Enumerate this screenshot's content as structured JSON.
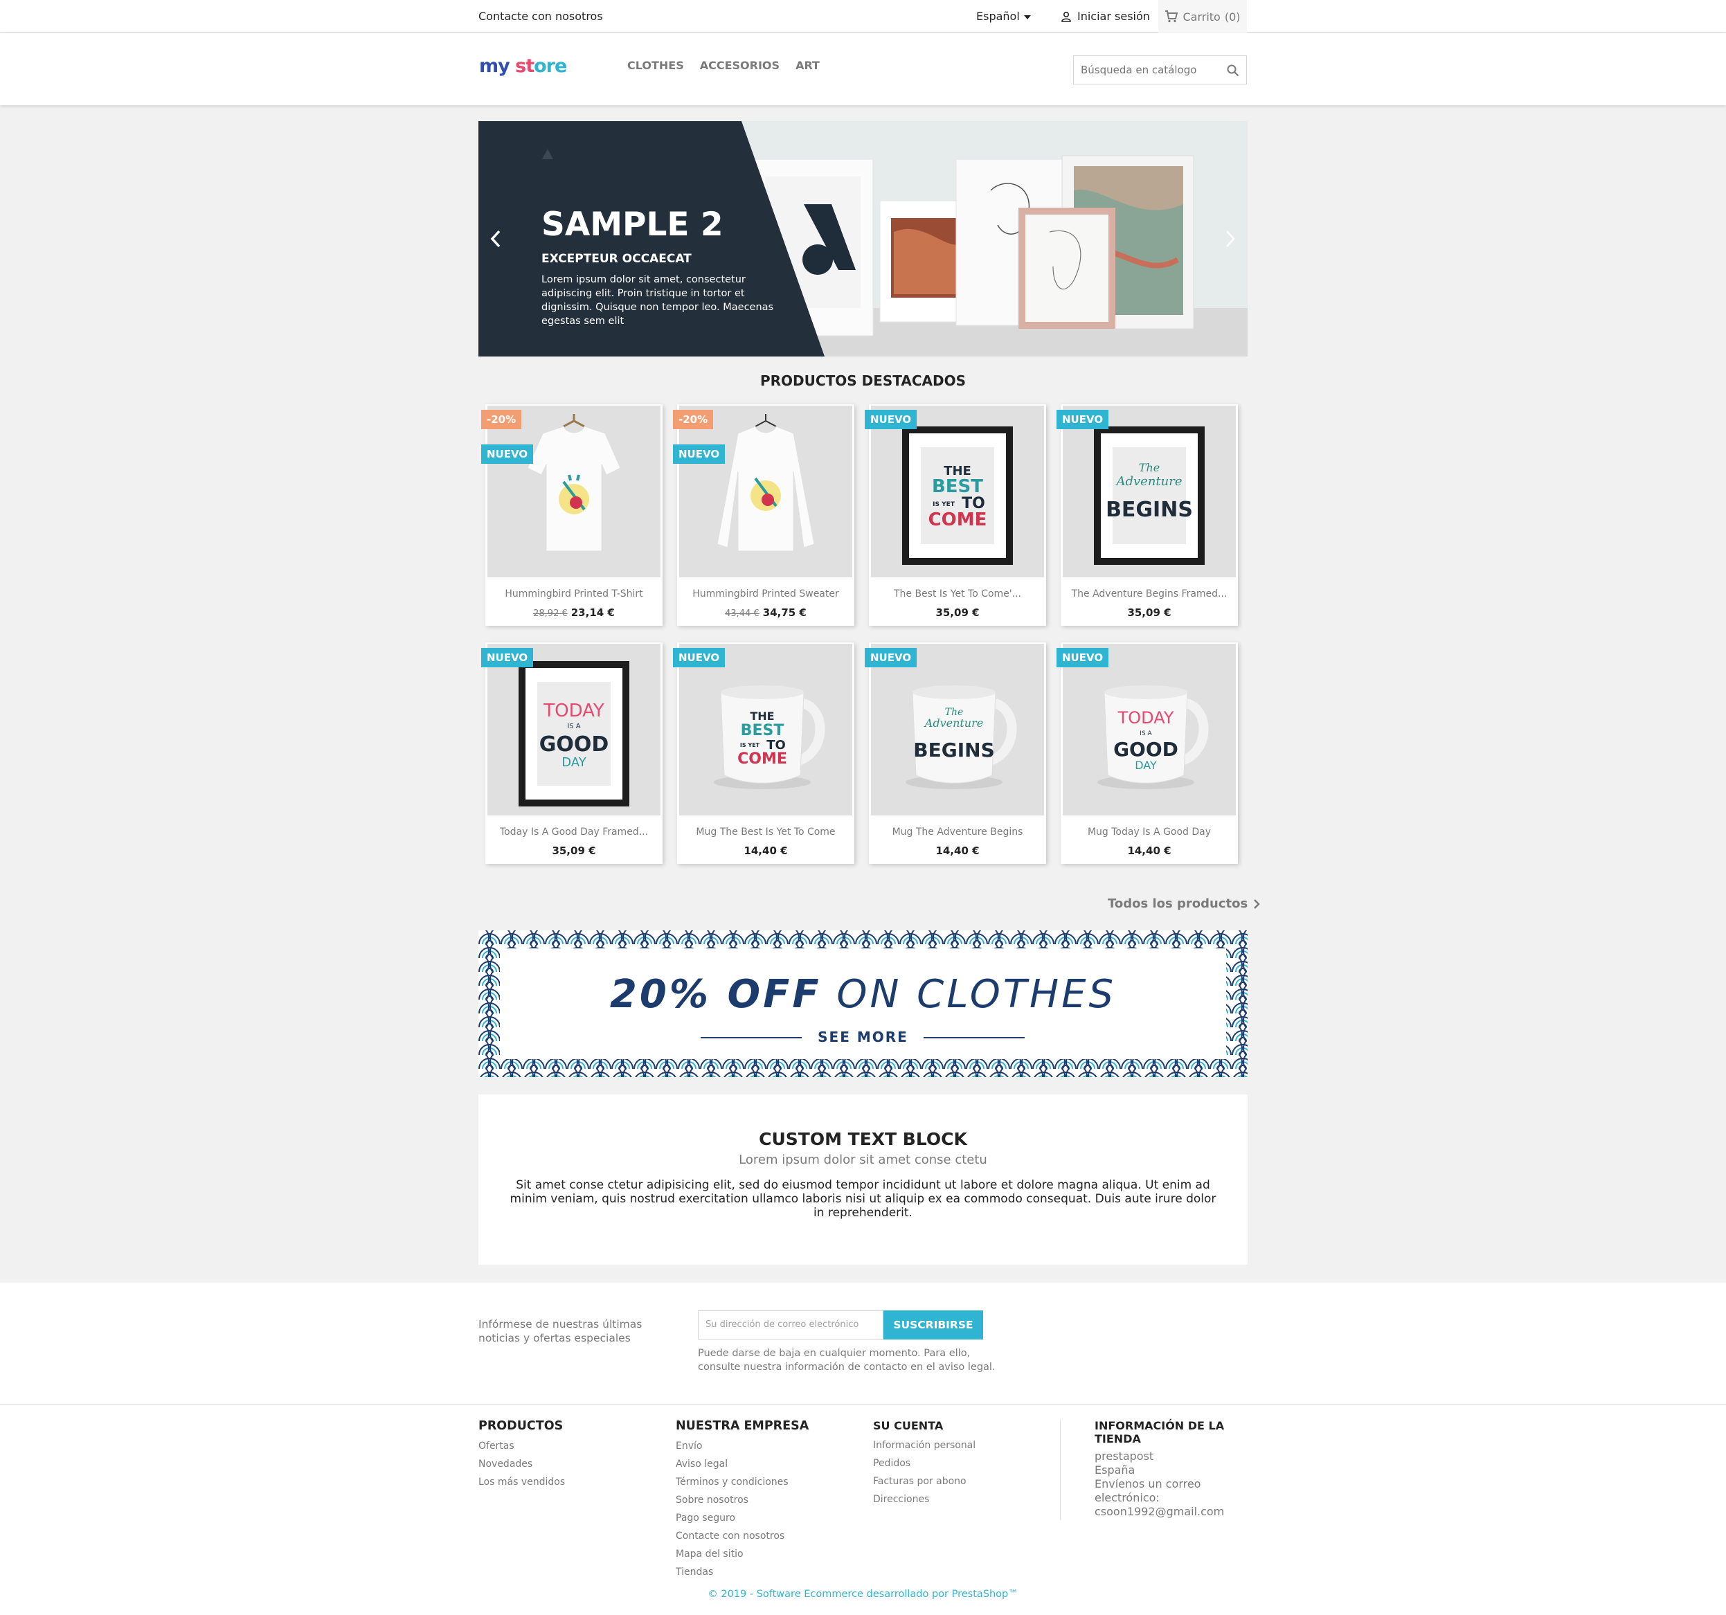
{
  "topbar": {
    "contact": "Contacte con nosotros",
    "language": "Español",
    "login": "Iniciar sesión",
    "cart": "Carrito",
    "cart_count": "(0)"
  },
  "header": {
    "logo_part1": "my",
    "logo_part2": "st",
    "logo_part3": "ore",
    "menu": [
      "CLOTHES",
      "ACCESORIOS",
      "ART"
    ],
    "search_placeholder": "Búsqueda en catálogo"
  },
  "slider": {
    "title": "SAMPLE 2",
    "subtitle": "EXCEPTEUR OCCAECAT",
    "description": "Lorem ipsum dolor sit amet, consectetur adipiscing elit. Proin tristique in tortor et dignissim. Quisque non tempor leo. Maecenas egestas sem elit"
  },
  "featured": {
    "title": "PRODUCTOS DESTACADOS",
    "all_link": "Todos los productos",
    "products": [
      {
        "name": "Hummingbird Printed T-Shirt",
        "old_price": "28,92 €",
        "price": "23,14 €",
        "discount": "-20%",
        "badge": "NUEVO",
        "image": "tshirt-icon"
      },
      {
        "name": "Hummingbird Printed Sweater",
        "old_price": "43,44 €",
        "price": "34,75 €",
        "discount": "-20%",
        "badge": "NUEVO",
        "image": "sweater-icon"
      },
      {
        "name": "The Best Is Yet To Come'...",
        "old_price": "",
        "price": "35,09 €",
        "discount": "",
        "badge": "NUEVO",
        "image": "frame-icon"
      },
      {
        "name": "The Adventure Begins Framed...",
        "old_price": "",
        "price": "35,09 €",
        "discount": "",
        "badge": "NUEVO",
        "image": "frame-icon"
      },
      {
        "name": "Today Is A Good Day Framed...",
        "old_price": "",
        "price": "35,09 €",
        "discount": "",
        "badge": "NUEVO",
        "image": "frame-icon"
      },
      {
        "name": "Mug The Best Is Yet To Come",
        "old_price": "",
        "price": "14,40 €",
        "discount": "",
        "badge": "NUEVO",
        "image": "mug-icon"
      },
      {
        "name": "Mug The Adventure Begins",
        "old_price": "",
        "price": "14,40 €",
        "discount": "",
        "badge": "NUEVO",
        "image": "mug-icon"
      },
      {
        "name": "Mug Today Is A Good Day",
        "old_price": "",
        "price": "14,40 €",
        "discount": "",
        "badge": "NUEVO",
        "image": "mug-icon"
      }
    ]
  },
  "artwork": {
    "best": [
      "THE",
      "BEST",
      "IS YET",
      "TO",
      "COME"
    ],
    "adventure": [
      "The",
      "Adventure",
      "BEGINS"
    ],
    "today": [
      "TODAY",
      "IS A",
      "GOOD",
      "DAY"
    ]
  },
  "promo": {
    "bold": "20% OFF",
    "rest": "ON CLOTHES",
    "see_more": "SEE MORE"
  },
  "custom_text": {
    "title": "CUSTOM TEXT BLOCK",
    "subtitle": "Lorem ipsum dolor sit amet conse ctetu",
    "body": "Sit amet conse ctetur adipisicing elit, sed do eiusmod tempor incididunt ut labore et dolore magna aliqua. Ut enim ad minim veniam, quis nostrud exercitation ullamco laboris nisi ut aliquip ex ea commodo consequat. Duis aute irure dolor in reprehenderit."
  },
  "newsletter": {
    "label": "Infórmese de nuestras últimas noticias y ofertas especiales",
    "placeholder": "Su dirección de correo electrónico",
    "button": "SUSCRIBIRSE",
    "note": "Puede darse de baja en cualquier momento. Para ello, consulte nuestra información de contacto en el aviso legal."
  },
  "footer": {
    "productos": {
      "title": "PRODUCTOS",
      "links": [
        "Ofertas",
        "Novedades",
        "Los más vendidos"
      ]
    },
    "empresa": {
      "title": "NUESTRA EMPRESA",
      "links": [
        "Envío",
        "Aviso legal",
        "Términos y condiciones",
        "Sobre nosotros",
        "Pago seguro",
        "Contacte con nosotros",
        "Mapa del sitio",
        "Tiendas"
      ]
    },
    "cuenta": {
      "title": "SU CUENTA",
      "links": [
        "Información personal",
        "Pedidos",
        "Facturas por abono",
        "Direcciones"
      ]
    },
    "info": {
      "title": "INFORMACIÓN DE LA TIENDA",
      "lines": [
        "prestapost",
        "España",
        "Envíenos un correo electrónico:",
        "csoon1992@gmail.com"
      ]
    },
    "copyright": "© 2019 - Software Ecommerce desarrollado por PrestaShop™"
  },
  "colors": {
    "accent": "#2fb5d2",
    "discount": "#f39d72",
    "promo_navy": "#1d3c6e",
    "slider_dark": "#232f3b"
  }
}
